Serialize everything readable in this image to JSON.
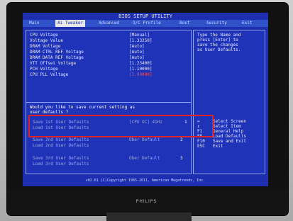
{
  "title": "BIOS SETUP UTILITY",
  "brand": "PHILIPS",
  "menu": [
    "Main",
    "Ai Tweaker",
    "Advanced",
    "O/C Profile",
    "Boot",
    "Security",
    "Exit"
  ],
  "voltages": [
    {
      "label": "CPU Voltage",
      "value": "[Manual]",
      "red": false
    },
    {
      "label": "  Voltage Value",
      "value": "[1.33250]",
      "red": false
    },
    {
      "label": "DRAM Voltage",
      "value": "[Auto]",
      "red": false
    },
    {
      "label": "DRAM CTRL REF Voltage",
      "value": "[Auto]",
      "red": false
    },
    {
      "label": "DRAM DATA REF Voltage",
      "value": "[Auto]",
      "red": false
    },
    {
      "label": "VTT Offset Voltage",
      "value": "[1.23400]",
      "red": false
    },
    {
      "label": "PCH Voltage",
      "value": "[1.10000]",
      "red": false
    },
    {
      "label": "CPU PLL Voltage",
      "value": "[1.90000]",
      "red": true
    }
  ],
  "dialog": {
    "question_line1": "Would you like to save current setting as",
    "question_line2": "user defaults ?"
  },
  "save_items": [
    {
      "save": "Save 1st User Defaults",
      "load": "Load 1st User Defaults",
      "name": "[CPU OC] 4GHz",
      "num": "1"
    },
    {
      "save": "Save 2nd User Defaults",
      "load": "Load 2nd User Defaults",
      "name": "Ober Default",
      "num": "2"
    },
    {
      "save": "Save 3rd User Defaults",
      "load": "Load 3rd User Defaults",
      "name": "Ober Default",
      "num": "3"
    }
  ],
  "help_text": [
    "Type the Name and",
    "press [Enter] to",
    "save the changes",
    "as User Defaults."
  ],
  "keys": [
    {
      "key": "↔",
      "desc": "Select Screen"
    },
    {
      "key": "↕",
      "desc": "Select Item"
    },
    {
      "key": "F1",
      "desc": "General Help"
    },
    {
      "key": "F9",
      "desc": "Load Defaults"
    },
    {
      "key": "F10",
      "desc": "Save and Exit"
    },
    {
      "key": "ESC",
      "desc": "Exit"
    }
  ],
  "footer": "v02.61 (C)Copyright 1985-2011, American Megatrends, Inc."
}
